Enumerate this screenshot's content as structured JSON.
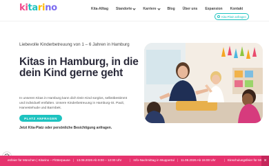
{
  "header": {
    "logo_text": "kitarino",
    "logo_parts": [
      "ki",
      "ta",
      "ri",
      "no"
    ],
    "nav": [
      {
        "label": "Kita-Alltag",
        "dropdown": false
      },
      {
        "label": "Standorte",
        "dropdown": true
      },
      {
        "label": "Karriere",
        "dropdown": true
      },
      {
        "label": "Blog",
        "dropdown": false
      },
      {
        "label": "Über uns",
        "dropdown": false
      },
      {
        "label": "Expansion",
        "dropdown": false
      },
      {
        "label": "Kontakt",
        "dropdown": false
      }
    ],
    "cta_label": "Kita-Platz anfragen"
  },
  "hero": {
    "subtitle": "Liebevolle Kinderbetreuung von 1 – 6 Jahren in Hamburg",
    "title": "Kitas in Hamburg, in die dein Kind gerne geht",
    "body": "In unseren Kitas in Hamburg kann dich Dein Kind sorglos, selbstbestimmt und individuell entfalten. Unsere Kinderbetreuung in Hamburg-St. Pauli, Harvestehude und Barmbek.",
    "button_label": "PLATZ ANFRAGEN",
    "link_text": "Jetzt Kita-Platz oder persönliche Besichtigung anfragen."
  },
  "ticker": {
    "items": [
      {
        "title": "enfeier für München | Kitarino – Flötterpause",
        "date": "13.08.2026 Ab 9:00 – 12:00 Uhr"
      },
      {
        "title": "Info-Nachmittag in Wuppertal",
        "date": "11.08.2026 Ab 15:00 Uhr"
      },
      {
        "title": "Einschulungsfeier für Mü",
        "date": ""
      }
    ],
    "close_label": "×"
  },
  "colors": {
    "brand_pink": "#f14b8d",
    "brand_teal": "#1ec3c0",
    "brand_yellow": "#ffb800",
    "brand_purple": "#7c6cf0",
    "ticker_bg": "#e6336e"
  },
  "icons": [
    "cookie-settings-icon",
    "location-pin-icon",
    "chevron-down-icon",
    "close-icon"
  ]
}
